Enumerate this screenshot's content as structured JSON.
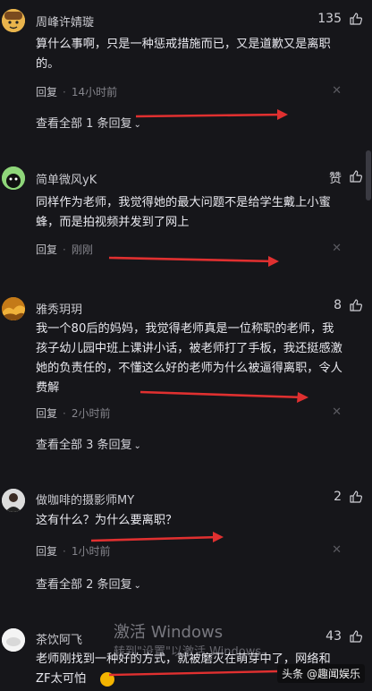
{
  "comments": [
    {
      "username": "周峰许婧璇",
      "likes": "135",
      "text": "算什么事啊，只是一种惩戒措施而已，又是道歉又是离职的。",
      "reply_label": "回复",
      "time": "14小时前",
      "more_replies": "查看全部 1 条回复"
    },
    {
      "username": "简单微风yK",
      "likes": "赞",
      "text": "同样作为老师，我觉得她的最大问题不是给学生戴上小蜜蜂，而是拍视频并发到了网上",
      "reply_label": "回复",
      "time": "刚刚",
      "more_replies": ""
    },
    {
      "username": "雅秀玥玥",
      "likes": "8",
      "text": "我一个80后的妈妈，我觉得老师真是一位称职的老师，我孩子幼儿园中班上课讲小话，被老师打了手板，我还挺感激她的负责任的，不懂这么好的老师为什么被逼得离职，令人费解",
      "reply_label": "回复",
      "time": "2小时前",
      "more_replies": "查看全部 3 条回复"
    },
    {
      "username": "做咖啡的摄影师MY",
      "likes": "2",
      "text": "这有什么？为什么要离职？",
      "reply_label": "回复",
      "time": "1小时前",
      "more_replies": "查看全部 2 条回复"
    },
    {
      "username": "茶饮阿飞",
      "likes": "43",
      "text": "老师刚找到一种好的方式，就被磨灭在萌芽中了，网络和ZF太可怕",
      "reply_label": "",
      "time": "",
      "more_replies": ""
    }
  ],
  "watermark": {
    "title": "激活 Windows",
    "subtitle": "转到\"设置\"以激活 Windows。"
  },
  "brand": "头条 @趣闻娱乐",
  "colors": {
    "background": "#16161a",
    "arrow": "#e03030",
    "text": "#e8e8ee",
    "muted": "#85858c"
  },
  "icons": [
    "thumbs-up-icon",
    "close-icon",
    "chevron-down-icon",
    "avatar"
  ]
}
